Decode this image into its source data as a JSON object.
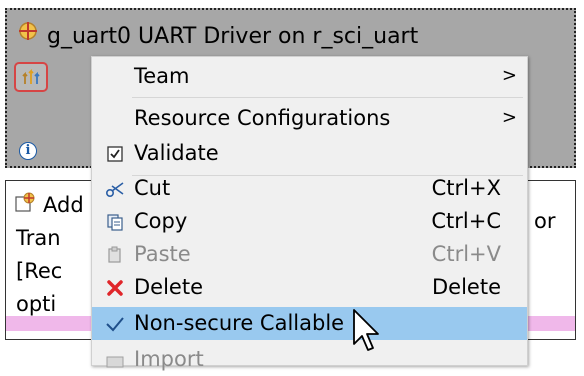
{
  "component": {
    "title": "g_uart0 UART Driver on r_sci_uart"
  },
  "description": {
    "lines": [
      "Add",
      "Tran",
      "[Rec",
      "opti"
    ],
    "right_fragment": "or"
  },
  "menu": {
    "items": [
      {
        "label": "Team",
        "shortcut": "",
        "submenu_arrow": ">"
      },
      {
        "label": "Resource Configurations",
        "shortcut": "",
        "submenu_arrow": ">"
      },
      {
        "label": "Validate",
        "shortcut": ""
      },
      {
        "label": "Cut",
        "shortcut": "Ctrl+X"
      },
      {
        "label": "Copy",
        "shortcut": "Ctrl+C"
      },
      {
        "label": "Paste",
        "shortcut": "Ctrl+V"
      },
      {
        "label": "Delete",
        "shortcut": "Delete"
      },
      {
        "label": "Non-secure Callable",
        "shortcut": ""
      },
      {
        "label": "Import",
        "shortcut": ""
      }
    ]
  },
  "colors": {
    "block_gray": "#a7a7a7",
    "menu_bg": "#f0f0f0",
    "highlight": "#99c9ef",
    "tool_border": "#d64545",
    "pink_band": "#f0b8ea"
  }
}
